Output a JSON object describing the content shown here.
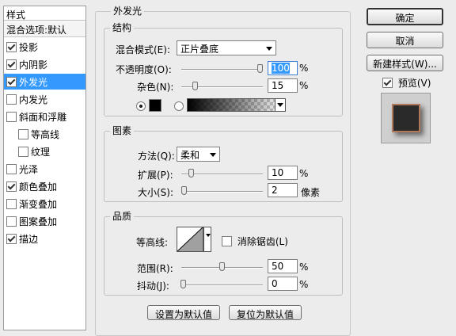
{
  "styles_panel": {
    "header": "样式",
    "items": [
      {
        "label": "混合选项:默认",
        "checkbox": false,
        "checked": false,
        "selected": false,
        "indent": false,
        "header": true
      },
      {
        "label": "投影",
        "checkbox": true,
        "checked": true,
        "selected": false,
        "indent": false
      },
      {
        "label": "内阴影",
        "checkbox": true,
        "checked": true,
        "selected": false,
        "indent": false
      },
      {
        "label": "外发光",
        "checkbox": true,
        "checked": true,
        "selected": true,
        "indent": false
      },
      {
        "label": "内发光",
        "checkbox": true,
        "checked": false,
        "selected": false,
        "indent": false
      },
      {
        "label": "斜面和浮雕",
        "checkbox": true,
        "checked": false,
        "selected": false,
        "indent": false
      },
      {
        "label": "等高线",
        "checkbox": true,
        "checked": false,
        "selected": false,
        "indent": true
      },
      {
        "label": "纹理",
        "checkbox": true,
        "checked": false,
        "selected": false,
        "indent": true
      },
      {
        "label": "光泽",
        "checkbox": true,
        "checked": false,
        "selected": false,
        "indent": false
      },
      {
        "label": "颜色叠加",
        "checkbox": true,
        "checked": true,
        "selected": false,
        "indent": false
      },
      {
        "label": "渐变叠加",
        "checkbox": true,
        "checked": false,
        "selected": false,
        "indent": false
      },
      {
        "label": "图案叠加",
        "checkbox": true,
        "checked": false,
        "selected": false,
        "indent": false
      },
      {
        "label": "描边",
        "checkbox": true,
        "checked": true,
        "selected": false,
        "indent": false
      }
    ]
  },
  "outer_glow": {
    "title": "外发光",
    "structure": {
      "title": "结构",
      "blend_mode_label": "混合模式(E):",
      "blend_mode_value": "正片叠底",
      "opacity_label": "不透明度(O):",
      "opacity_value": "100",
      "opacity_unit": "%",
      "opacity_level": 1.0,
      "noise_label": "杂色(N):",
      "noise_value": "15",
      "noise_unit": "%",
      "noise_level": 0.15,
      "color_swatch": "#000000"
    },
    "elements": {
      "title": "图素",
      "technique_label": "方法(Q):",
      "technique_value": "柔和",
      "spread_label": "扩展(P):",
      "spread_value": "10",
      "spread_unit": "%",
      "spread_level": 0.1,
      "size_label": "大小(S):",
      "size_value": "2",
      "size_unit": "像素",
      "size_level": 0.01
    },
    "quality": {
      "title": "品质",
      "contour_label": "等高线:",
      "antialias_label": "消除锯齿(L)",
      "antialias_checked": false,
      "range_label": "范围(R):",
      "range_value": "50",
      "range_unit": "%",
      "range_level": 0.5,
      "jitter_label": "抖动(J):",
      "jitter_value": "0",
      "jitter_unit": "%",
      "jitter_level": 0.0
    },
    "make_default_label": "设置为默认值",
    "reset_default_label": "复位为默认值"
  },
  "right_panel": {
    "ok_label": "确定",
    "cancel_label": "取消",
    "new_style_label": "新建样式(W)...",
    "preview_label": "预览(V)",
    "preview_checked": true
  }
}
